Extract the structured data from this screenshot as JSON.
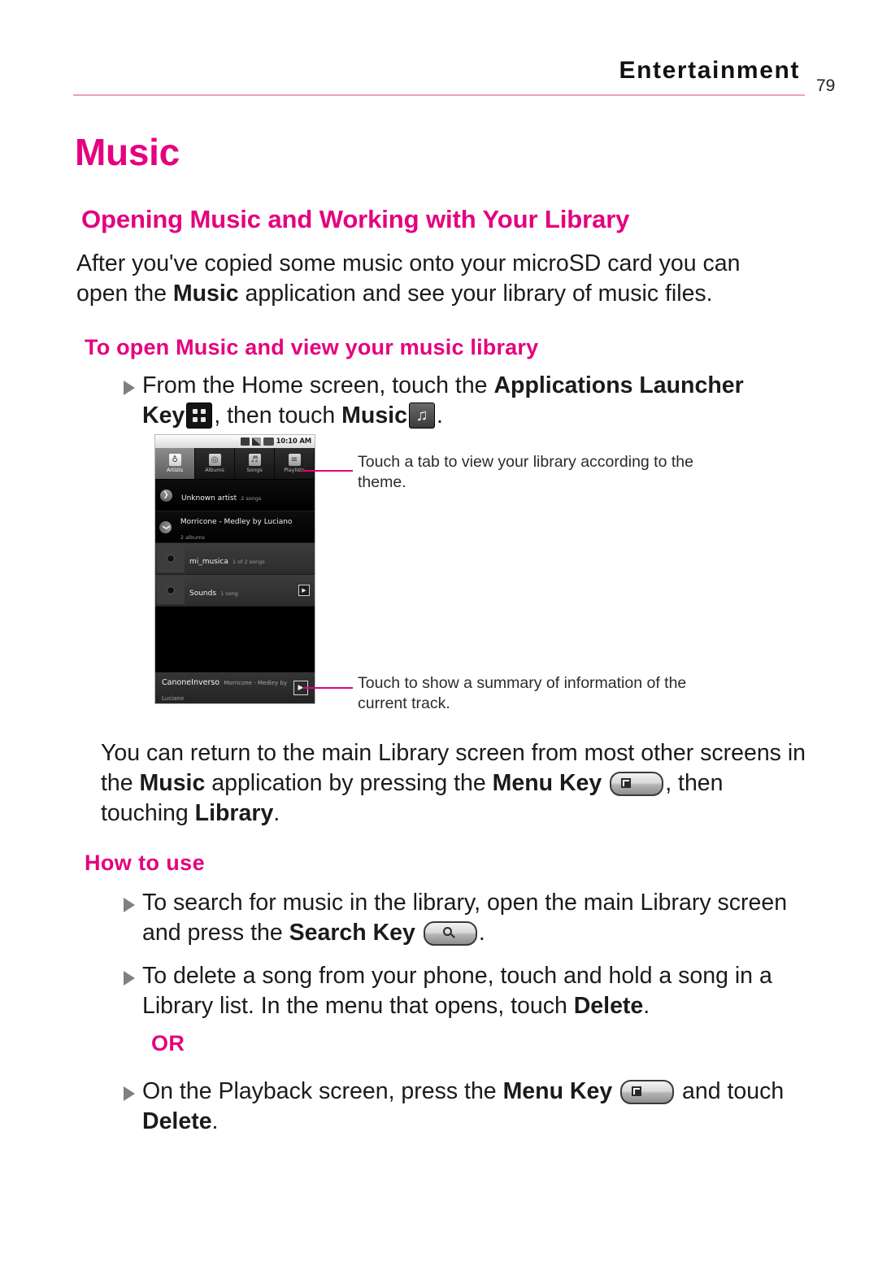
{
  "header": {
    "title": "Entertainment",
    "page_number": "79"
  },
  "headings": {
    "h1": "Music",
    "h2": "Opening Music and Working with Your Library",
    "h3_open": "To open Music and view your music library",
    "h3_howto": "How to use",
    "or": "OR"
  },
  "paragraphs": {
    "intro_part1": "After you've copied some music onto your microSD card you can open the ",
    "intro_bold1": "Music",
    "intro_part2": " application and see your library of music files.",
    "return_part1": "You can return to the main Library screen from most other screens in the ",
    "return_bold1": "Music",
    "return_part2": " application by pressing the ",
    "return_bold2": "Menu Key",
    "return_part3": ", then touching ",
    "return_bold3": "Library",
    "return_part4": "."
  },
  "bullets": {
    "open_part1": "From the Home screen, touch the ",
    "open_bold1": "Applications Launcher Key",
    "open_part2": ", then touch ",
    "open_bold2": "Music",
    "open_part3": ".",
    "search_part1": "To search for music in the library, open the main Library screen and press the ",
    "search_bold1": "Search Key",
    "search_part2": ".",
    "delete_part1": "To delete a song from your phone, touch and hold a song in a Library list. In the menu that opens, touch ",
    "delete_bold1": "Delete",
    "delete_part2": ".",
    "playback_part1": "On the Playback screen, press the ",
    "playback_bold1": "Menu Key",
    "playback_part2": " and touch ",
    "playback_bold2": "Delete",
    "playback_part3": "."
  },
  "callouts": {
    "top": "Touch a tab to view your library according to the theme.",
    "bottom": "Touch to show a summary of information of the current track."
  },
  "phone_screenshot": {
    "status_time": "10:10 AM",
    "tabs": [
      {
        "label": "Artists",
        "icon": "microphone-icon",
        "glyph": "♁",
        "active": true
      },
      {
        "label": "Albums",
        "icon": "album-icon",
        "glyph": "◎",
        "active": false
      },
      {
        "label": "Songs",
        "icon": "song-note-icon",
        "glyph": "♬",
        "active": false
      },
      {
        "label": "Playlists",
        "icon": "playlist-icon",
        "glyph": "≡",
        "active": false
      }
    ],
    "rows": [
      {
        "title": "Unknown artist",
        "sub": "2 songs",
        "type": "artist",
        "chevron": "❯",
        "play": false
      },
      {
        "title": "Morricone - Medley by Luciano",
        "sub": "2 albums",
        "type": "artist",
        "chevron": "❯",
        "play": false
      },
      {
        "title": "mi_musica",
        "sub": "1 of 2 songs",
        "type": "album",
        "chevron": "",
        "play": false
      },
      {
        "title": "Sounds",
        "sub": "1 song",
        "type": "album",
        "chevron": "",
        "play": true
      }
    ],
    "now_playing": {
      "title": "CanoneInverso",
      "artist": "Morricone - Medley by Luciano",
      "play_glyph": "▶"
    }
  },
  "colors": {
    "accent": "#e4007f",
    "rule": "#f39ac5",
    "body_text": "#1b1b1b"
  }
}
